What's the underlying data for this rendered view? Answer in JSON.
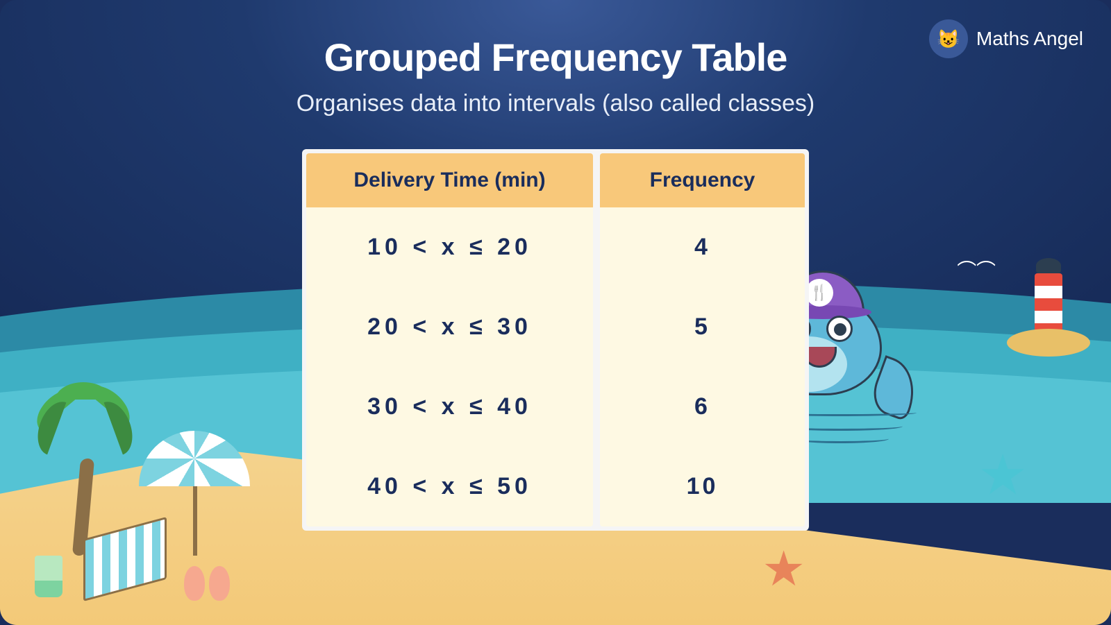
{
  "brand": {
    "name": "Maths Angel"
  },
  "title": "Grouped Frequency Table",
  "subtitle": "Organises data into intervals (also called classes)",
  "table": {
    "headers": {
      "col1": "Delivery Time (min)",
      "col2": "Frequency"
    },
    "rows": [
      {
        "interval": "10  <  x  ≤  20",
        "frequency": "4"
      },
      {
        "interval": "20  <  x  ≤  30",
        "frequency": "5"
      },
      {
        "interval": "30  <  x  ≤  40",
        "frequency": "6"
      },
      {
        "interval": "40  <  x  ≤  50",
        "frequency": "10"
      }
    ]
  },
  "chart_data": {
    "type": "table",
    "title": "Grouped Frequency Table",
    "columns": [
      "Delivery Time (min)",
      "Frequency"
    ],
    "rows": [
      [
        "10 < x ≤ 20",
        4
      ],
      [
        "20 < x ≤ 30",
        5
      ],
      [
        "30 < x ≤ 40",
        6
      ],
      [
        "40 < x ≤ 50",
        10
      ]
    ]
  }
}
